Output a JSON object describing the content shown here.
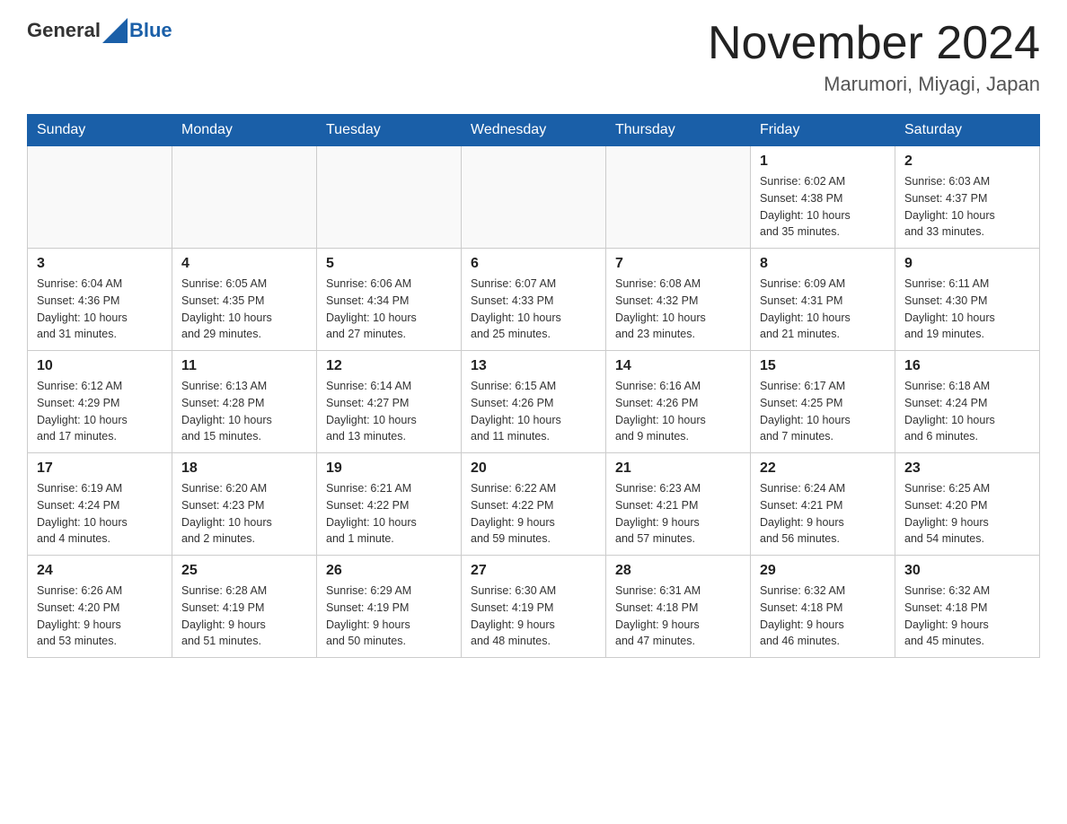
{
  "header": {
    "logo_general": "General",
    "logo_blue": "Blue",
    "month_title": "November 2024",
    "location": "Marumori, Miyagi, Japan"
  },
  "days_of_week": [
    "Sunday",
    "Monday",
    "Tuesday",
    "Wednesday",
    "Thursday",
    "Friday",
    "Saturday"
  ],
  "weeks": [
    [
      {
        "day": "",
        "info": ""
      },
      {
        "day": "",
        "info": ""
      },
      {
        "day": "",
        "info": ""
      },
      {
        "day": "",
        "info": ""
      },
      {
        "day": "",
        "info": ""
      },
      {
        "day": "1",
        "info": "Sunrise: 6:02 AM\nSunset: 4:38 PM\nDaylight: 10 hours\nand 35 minutes."
      },
      {
        "day": "2",
        "info": "Sunrise: 6:03 AM\nSunset: 4:37 PM\nDaylight: 10 hours\nand 33 minutes."
      }
    ],
    [
      {
        "day": "3",
        "info": "Sunrise: 6:04 AM\nSunset: 4:36 PM\nDaylight: 10 hours\nand 31 minutes."
      },
      {
        "day": "4",
        "info": "Sunrise: 6:05 AM\nSunset: 4:35 PM\nDaylight: 10 hours\nand 29 minutes."
      },
      {
        "day": "5",
        "info": "Sunrise: 6:06 AM\nSunset: 4:34 PM\nDaylight: 10 hours\nand 27 minutes."
      },
      {
        "day": "6",
        "info": "Sunrise: 6:07 AM\nSunset: 4:33 PM\nDaylight: 10 hours\nand 25 minutes."
      },
      {
        "day": "7",
        "info": "Sunrise: 6:08 AM\nSunset: 4:32 PM\nDaylight: 10 hours\nand 23 minutes."
      },
      {
        "day": "8",
        "info": "Sunrise: 6:09 AM\nSunset: 4:31 PM\nDaylight: 10 hours\nand 21 minutes."
      },
      {
        "day": "9",
        "info": "Sunrise: 6:11 AM\nSunset: 4:30 PM\nDaylight: 10 hours\nand 19 minutes."
      }
    ],
    [
      {
        "day": "10",
        "info": "Sunrise: 6:12 AM\nSunset: 4:29 PM\nDaylight: 10 hours\nand 17 minutes."
      },
      {
        "day": "11",
        "info": "Sunrise: 6:13 AM\nSunset: 4:28 PM\nDaylight: 10 hours\nand 15 minutes."
      },
      {
        "day": "12",
        "info": "Sunrise: 6:14 AM\nSunset: 4:27 PM\nDaylight: 10 hours\nand 13 minutes."
      },
      {
        "day": "13",
        "info": "Sunrise: 6:15 AM\nSunset: 4:26 PM\nDaylight: 10 hours\nand 11 minutes."
      },
      {
        "day": "14",
        "info": "Sunrise: 6:16 AM\nSunset: 4:26 PM\nDaylight: 10 hours\nand 9 minutes."
      },
      {
        "day": "15",
        "info": "Sunrise: 6:17 AM\nSunset: 4:25 PM\nDaylight: 10 hours\nand 7 minutes."
      },
      {
        "day": "16",
        "info": "Sunrise: 6:18 AM\nSunset: 4:24 PM\nDaylight: 10 hours\nand 6 minutes."
      }
    ],
    [
      {
        "day": "17",
        "info": "Sunrise: 6:19 AM\nSunset: 4:24 PM\nDaylight: 10 hours\nand 4 minutes."
      },
      {
        "day": "18",
        "info": "Sunrise: 6:20 AM\nSunset: 4:23 PM\nDaylight: 10 hours\nand 2 minutes."
      },
      {
        "day": "19",
        "info": "Sunrise: 6:21 AM\nSunset: 4:22 PM\nDaylight: 10 hours\nand 1 minute."
      },
      {
        "day": "20",
        "info": "Sunrise: 6:22 AM\nSunset: 4:22 PM\nDaylight: 9 hours\nand 59 minutes."
      },
      {
        "day": "21",
        "info": "Sunrise: 6:23 AM\nSunset: 4:21 PM\nDaylight: 9 hours\nand 57 minutes."
      },
      {
        "day": "22",
        "info": "Sunrise: 6:24 AM\nSunset: 4:21 PM\nDaylight: 9 hours\nand 56 minutes."
      },
      {
        "day": "23",
        "info": "Sunrise: 6:25 AM\nSunset: 4:20 PM\nDaylight: 9 hours\nand 54 minutes."
      }
    ],
    [
      {
        "day": "24",
        "info": "Sunrise: 6:26 AM\nSunset: 4:20 PM\nDaylight: 9 hours\nand 53 minutes."
      },
      {
        "day": "25",
        "info": "Sunrise: 6:28 AM\nSunset: 4:19 PM\nDaylight: 9 hours\nand 51 minutes."
      },
      {
        "day": "26",
        "info": "Sunrise: 6:29 AM\nSunset: 4:19 PM\nDaylight: 9 hours\nand 50 minutes."
      },
      {
        "day": "27",
        "info": "Sunrise: 6:30 AM\nSunset: 4:19 PM\nDaylight: 9 hours\nand 48 minutes."
      },
      {
        "day": "28",
        "info": "Sunrise: 6:31 AM\nSunset: 4:18 PM\nDaylight: 9 hours\nand 47 minutes."
      },
      {
        "day": "29",
        "info": "Sunrise: 6:32 AM\nSunset: 4:18 PM\nDaylight: 9 hours\nand 46 minutes."
      },
      {
        "day": "30",
        "info": "Sunrise: 6:32 AM\nSunset: 4:18 PM\nDaylight: 9 hours\nand 45 minutes."
      }
    ]
  ]
}
